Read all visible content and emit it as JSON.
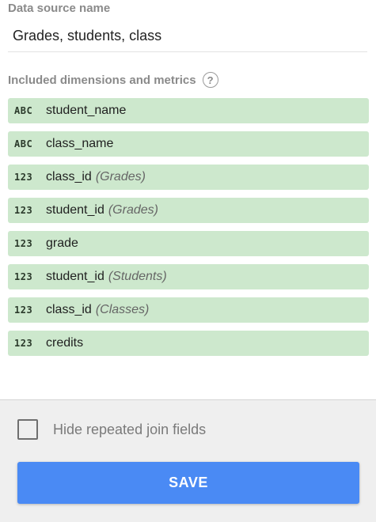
{
  "data_source": {
    "label": "Data source name",
    "value": "Grades, students, class"
  },
  "fields_section": {
    "title": "Included dimensions and metrics",
    "help_icon": "question-circle-icon",
    "items": [
      {
        "type_label": "ABC",
        "type_icon": "text-type-icon",
        "name": "student_name",
        "source": ""
      },
      {
        "type_label": "ABC",
        "type_icon": "text-type-icon",
        "name": "class_name",
        "source": ""
      },
      {
        "type_label": "123",
        "type_icon": "number-type-icon",
        "name": "class_id",
        "source": "(Grades)"
      },
      {
        "type_label": "123",
        "type_icon": "number-type-icon",
        "name": "student_id",
        "source": "(Grades)"
      },
      {
        "type_label": "123",
        "type_icon": "number-type-icon",
        "name": "grade",
        "source": ""
      },
      {
        "type_label": "123",
        "type_icon": "number-type-icon",
        "name": "student_id",
        "source": "(Students)"
      },
      {
        "type_label": "123",
        "type_icon": "number-type-icon",
        "name": "class_id",
        "source": "(Classes)"
      },
      {
        "type_label": "123",
        "type_icon": "number-type-icon",
        "name": "credits",
        "source": ""
      }
    ]
  },
  "footer": {
    "checkbox_label": "Hide repeated join fields",
    "checkbox_checked": false,
    "save_label": "SAVE"
  },
  "colors": {
    "field_background": "#cde8cd",
    "save_button": "#4a8af4",
    "footer_background": "#efefef"
  }
}
